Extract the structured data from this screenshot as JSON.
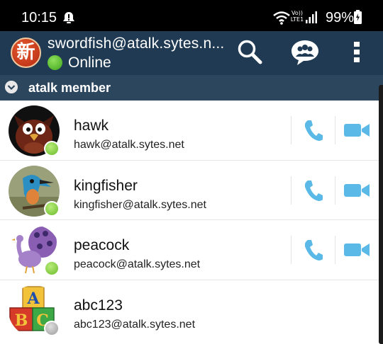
{
  "status_bar": {
    "time": "10:15",
    "network_badge": "Vo)) LTE1",
    "battery": "99%",
    "icons": [
      "alert-icon",
      "wifi-icon",
      "signal-icon",
      "battery-icon"
    ]
  },
  "app_bar": {
    "logo_char": "新",
    "account": "swordfish@atalk.sytes.n...",
    "status": "Online",
    "status_color": "#3fa41d",
    "actions": [
      "search-icon",
      "group-chat-icon",
      "overflow-menu-icon"
    ]
  },
  "group": {
    "title": "atalk member",
    "expanded": true
  },
  "contacts": [
    {
      "name": "hawk",
      "jid": "hawk@atalk.sytes.net",
      "presence": "online",
      "call": true,
      "video": true
    },
    {
      "name": "kingfisher",
      "jid": "kingfisher@atalk.sytes.net",
      "presence": "online",
      "call": true,
      "video": true
    },
    {
      "name": "peacock",
      "jid": "peacock@atalk.sytes.net",
      "presence": "online",
      "call": true,
      "video": true
    },
    {
      "name": "abc123",
      "jid": "abc123@atalk.sytes.net",
      "presence": "offline",
      "call": false,
      "video": false
    }
  ],
  "colors": {
    "app_bar": "#1f3a52",
    "group_header": "#2c465e",
    "action_blue": "#5ab9e6",
    "online": "#6bbb2a",
    "offline": "#9a9a9a"
  }
}
